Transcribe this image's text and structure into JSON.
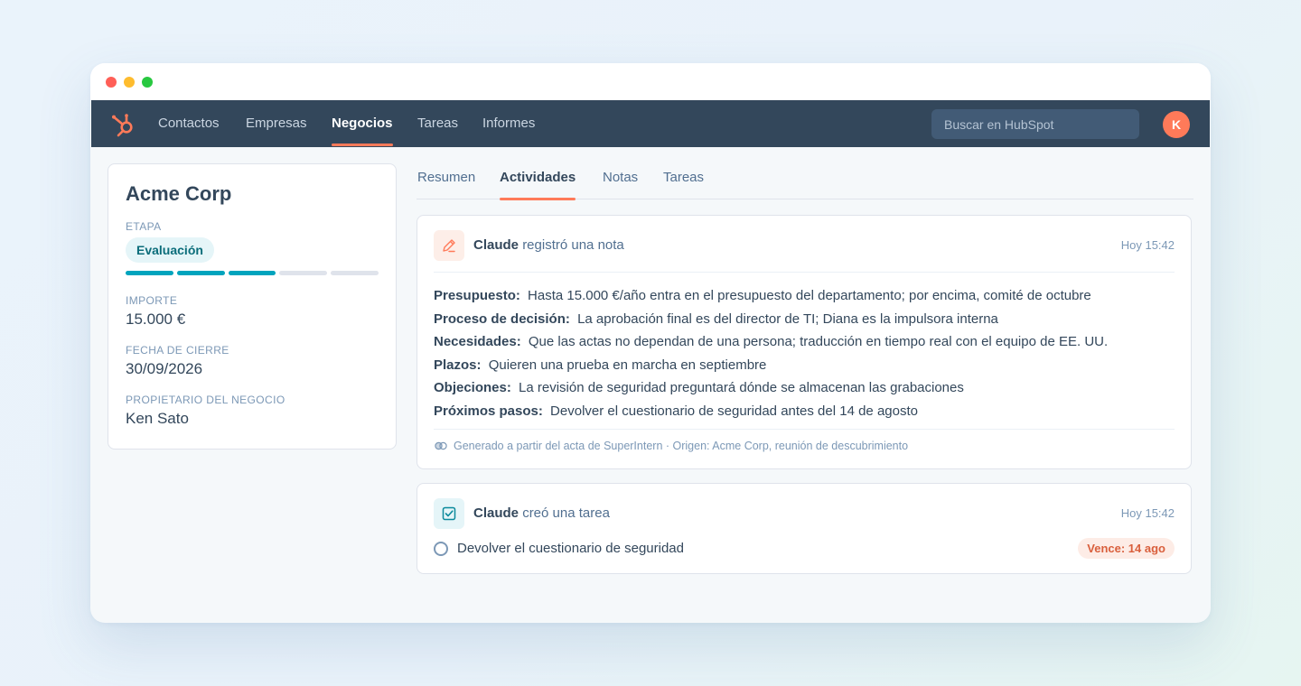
{
  "window": {
    "controls": [
      "close",
      "minimize",
      "maximize"
    ]
  },
  "topnav": {
    "logo_icon": "hubspot-sprocket-icon",
    "items": [
      {
        "label": "Contactos",
        "active": false
      },
      {
        "label": "Empresas",
        "active": false
      },
      {
        "label": "Negocios",
        "active": true
      },
      {
        "label": "Tareas",
        "active": false
      },
      {
        "label": "Informes",
        "active": false
      }
    ],
    "search_placeholder": "Buscar en HubSpot",
    "avatar_initial": "K"
  },
  "deal": {
    "name": "Acme Corp",
    "stage_label": "ETAPA",
    "stage_value": "Evaluación",
    "stage_progress": {
      "completed": 3,
      "total": 5
    },
    "amount_label": "IMPORTE",
    "amount_value": "15.000 €",
    "close_date_label": "FECHA DE CIERRE",
    "close_date_value": "30/09/2026",
    "owner_label": "PROPIETARIO DEL NEGOCIO",
    "owner_value": "Ken Sato"
  },
  "tabs": [
    {
      "label": "Resumen",
      "active": false
    },
    {
      "label": "Actividades",
      "active": true
    },
    {
      "label": "Notas",
      "active": false
    },
    {
      "label": "Tareas",
      "active": false
    }
  ],
  "note_activity": {
    "icon": "pencil-icon",
    "actor": "Claude",
    "action": "registró una nota",
    "timestamp": "Hoy 15:42",
    "rows": [
      {
        "label": "Presupuesto:",
        "text": "Hasta 15.000 €/año entra en el presupuesto del departamento; por encima, comité de octubre"
      },
      {
        "label": "Proceso de decisión:",
        "text": "La aprobación final es del director de TI; Diana es la impulsora interna"
      },
      {
        "label": "Necesidades:",
        "text": "Que las actas no dependan de una persona; traducción en tiempo real con el equipo de EE. UU."
      },
      {
        "label": "Plazos:",
        "text": "Quieren una prueba en marcha en septiembre"
      },
      {
        "label": "Objeciones:",
        "text": "La revisión de seguridad preguntará dónde se almacenan las grabaciones"
      },
      {
        "label": "Próximos pasos:",
        "text": "Devolver el cuestionario de seguridad antes del 14 de agosto"
      }
    ],
    "footer_icon": "link-icon",
    "footer": "Generado a partir del acta de SuperIntern · Origen: Acme Corp, reunión de descubrimiento"
  },
  "task_activity": {
    "icon": "checkbox-icon",
    "actor": "Claude",
    "action": "creó una tarea",
    "timestamp": "Hoy 15:42",
    "task_title": "Devolver el cuestionario de seguridad",
    "due_badge": "Vence: 14 ago"
  },
  "colors": {
    "nav_bg": "#33475b",
    "accent": "#ff7a59",
    "teal": "#00a4bd",
    "due_text": "#d95f3c"
  }
}
